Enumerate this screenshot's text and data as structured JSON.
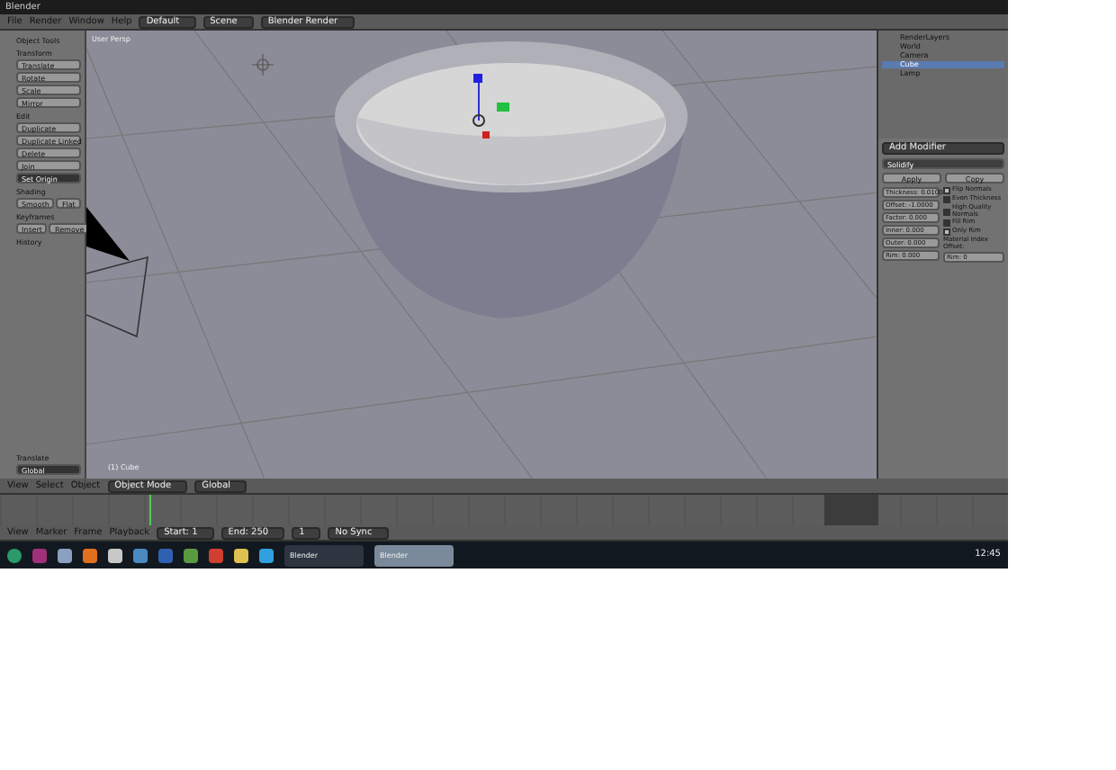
{
  "window": {
    "title": "Blender"
  },
  "menu": [
    "File",
    "Render",
    "Window",
    "Help"
  ],
  "header_fields": [
    "Default",
    "Scene",
    "Blender Render"
  ],
  "tool_shelf": {
    "title": "Object Tools",
    "groups": [
      {
        "title": "Transform",
        "buttons": [
          "Translate",
          "Rotate",
          "Scale"
        ]
      },
      {
        "buttons": [
          "Mirror"
        ]
      },
      {
        "title": "Edit",
        "buttons": [
          "Duplicate",
          "Duplicate Linked",
          "Delete",
          "Join"
        ]
      },
      {
        "buttons": [
          "Set Origin"
        ],
        "dark": true
      },
      {
        "title": "Shading",
        "pairs": [
          [
            "Smooth",
            "Flat"
          ]
        ]
      },
      {
        "title": "Keyframes",
        "pairs": [
          [
            "Insert",
            "Remove"
          ]
        ]
      }
    ],
    "collapsed": "History",
    "operator": {
      "title": "Translate",
      "field": "Global"
    }
  },
  "viewport": {
    "label": "User Persp",
    "object": "(1) Cube"
  },
  "view_header": {
    "menu": [
      "View",
      "Select",
      "Object"
    ],
    "mode": "Object Mode",
    "orientation": "Global"
  },
  "timeline_header": {
    "menu": [
      "View",
      "Marker",
      "Frame",
      "Playback"
    ],
    "start": "Start: 1",
    "end": "End: 250",
    "frame": "1",
    "sync": "No Sync"
  },
  "outliner": {
    "items": [
      {
        "name": "RenderLayers",
        "selected": false
      },
      {
        "name": "World",
        "selected": false
      },
      {
        "name": "Camera",
        "selected": false
      },
      {
        "name": "Cube",
        "selected": true
      },
      {
        "name": "Lamp",
        "selected": false
      }
    ]
  },
  "properties": {
    "add": "Add Modifier",
    "modifier": "Solidify",
    "actions": [
      "Apply",
      "Copy"
    ],
    "fields": [
      "Thickness: 0.0100",
      "Offset: -1.0000",
      "Factor: 0.000",
      "Inner: 0.000",
      "Outer: 0.000",
      "Rim: 0.000"
    ],
    "checks": [
      {
        "label": "Flip Normals",
        "checked": false
      },
      {
        "label": "Even Thickness",
        "checked": true
      },
      {
        "label": "High Quality Normals",
        "checked": true
      },
      {
        "label": "Fill Rim",
        "checked": true
      },
      {
        "label": "Only Rim",
        "checked": false
      }
    ],
    "material_label": "Material Index Offset:",
    "material_field": "Rim: 0"
  },
  "taskbar": {
    "windows": [
      {
        "label": "Blender",
        "selected": false
      },
      {
        "label": "Blender",
        "selected": true
      }
    ],
    "clock": "12:45"
  }
}
